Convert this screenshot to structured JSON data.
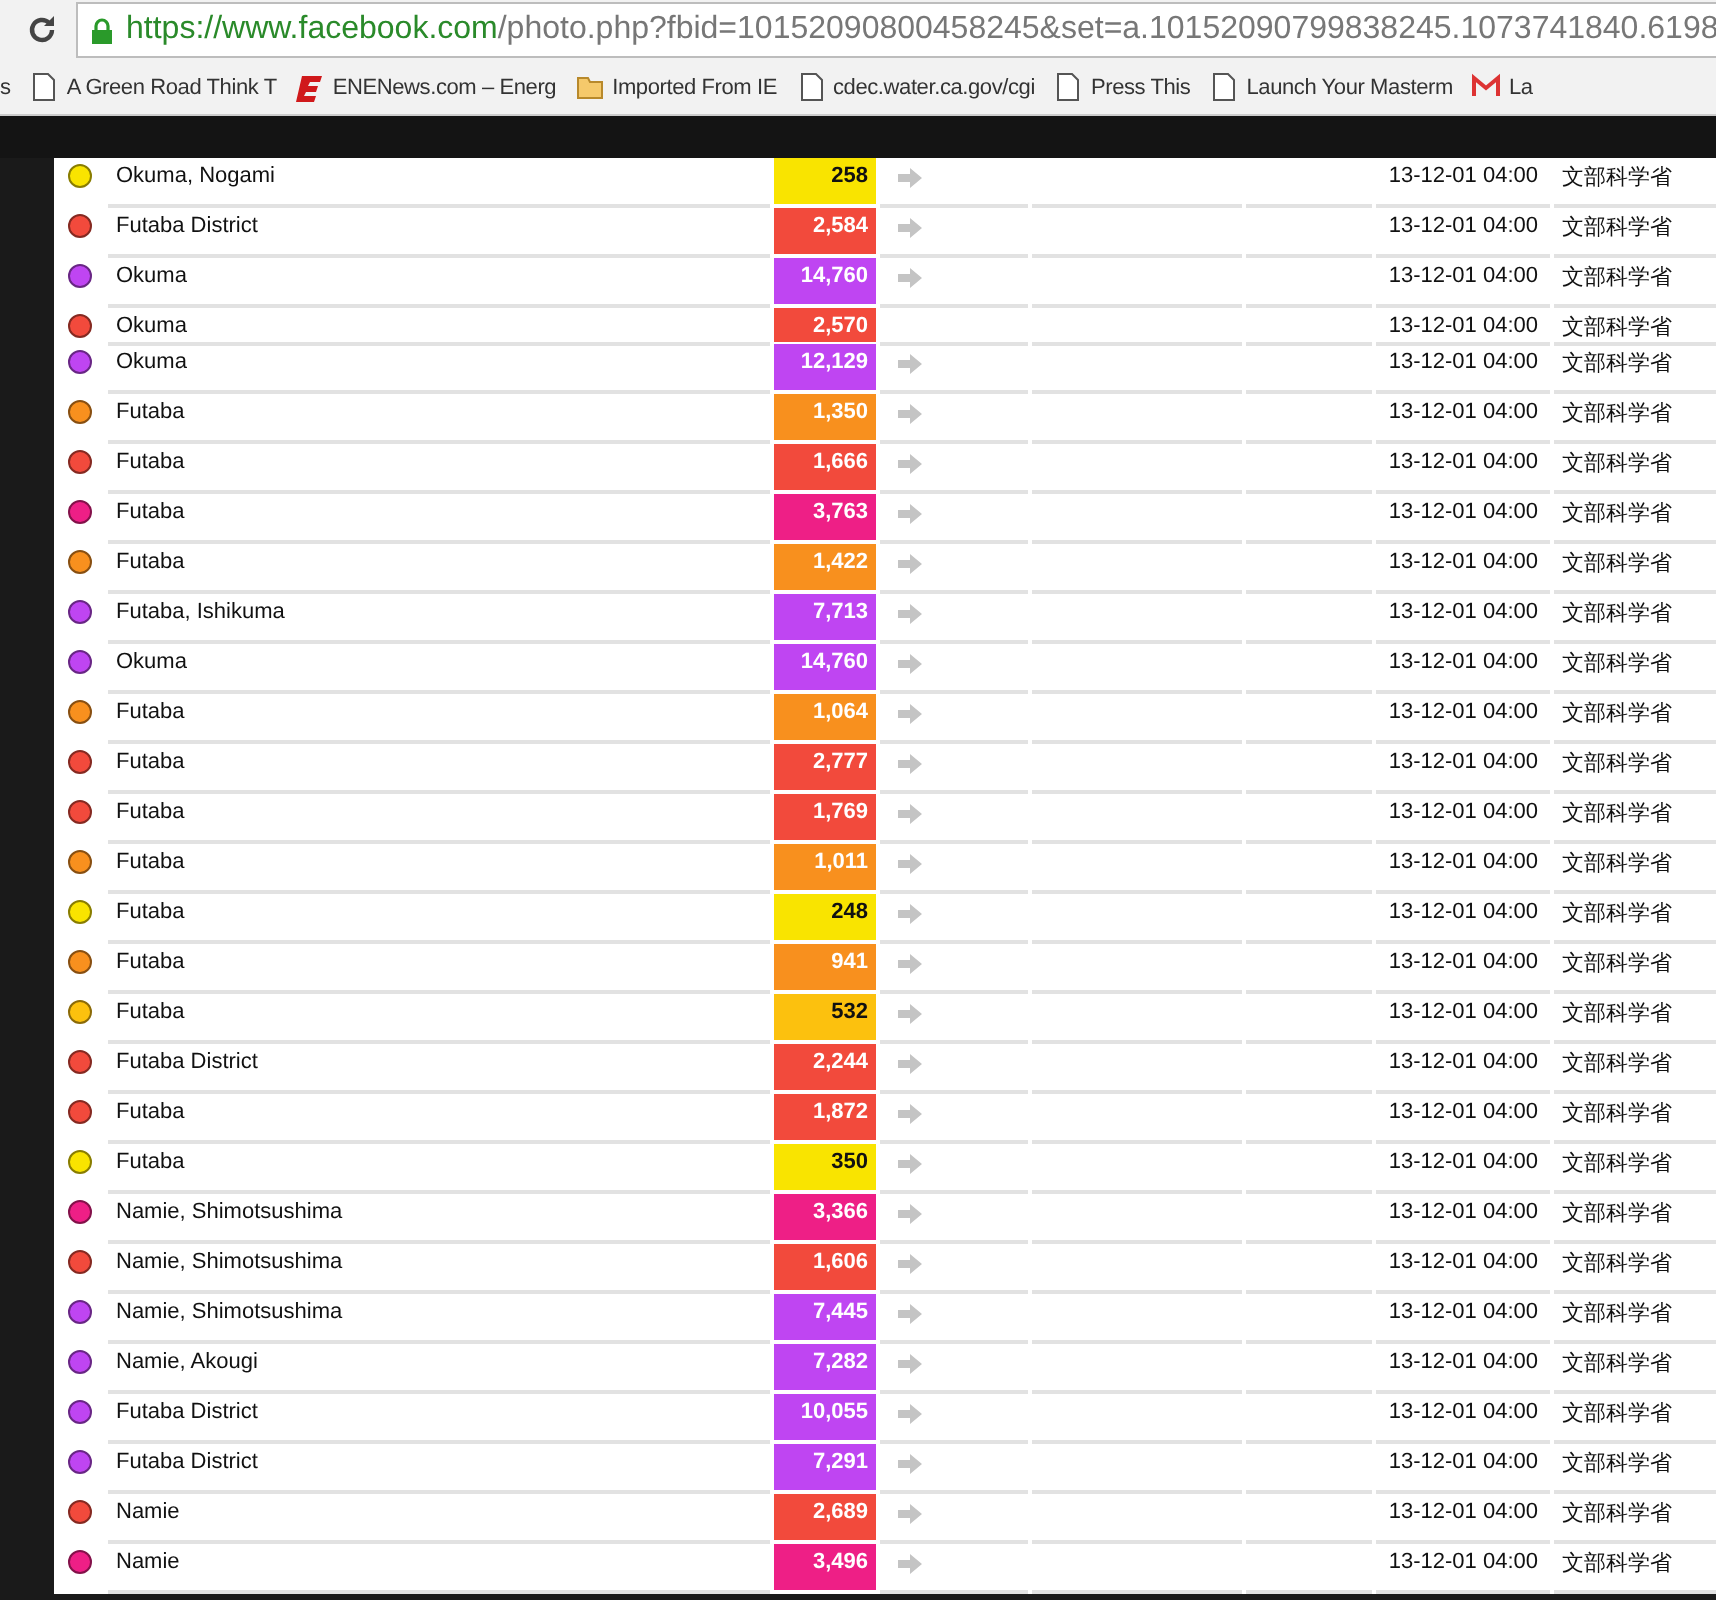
{
  "browser": {
    "url_host": "https://www.facebook.com",
    "url_path": "/photo.php?fbid=10152090800458245&set=a.10152090799838245.1073741840.6198",
    "bookmarks": [
      {
        "kind": "cut",
        "label": "s"
      },
      {
        "kind": "page",
        "label": "A Green Road Think T"
      },
      {
        "kind": "logo",
        "label": "ENENews.com – Energ"
      },
      {
        "kind": "folder",
        "label": "Imported From IE"
      },
      {
        "kind": "page",
        "label": "cdec.water.ca.gov/cgi"
      },
      {
        "kind": "page",
        "label": "Press This"
      },
      {
        "kind": "page",
        "label": "Launch Your Masterm"
      },
      {
        "kind": "mail",
        "label": "La"
      }
    ]
  },
  "table": {
    "rows": [
      {
        "name": "Okuma, Nogami",
        "value": "258",
        "color": "#f9e400",
        "arrow": true,
        "time": "13-12-01 04:00",
        "source": "文部科学省"
      },
      {
        "name": "Futaba District",
        "value": "2,584",
        "color": "#f24a3c",
        "arrow": true,
        "time": "13-12-01 04:00",
        "source": "文部科学省"
      },
      {
        "name": "Okuma",
        "value": "14,760",
        "color": "#bf45f2",
        "arrow": true,
        "time": "13-12-01 04:00",
        "source": "文部科学省"
      },
      {
        "name": "Okuma",
        "value": "2,570",
        "color": "#f24a3c",
        "arrow": false,
        "time": "13-12-01 04:00",
        "source": "文部科学省"
      },
      {
        "name": "Okuma",
        "value": "12,129",
        "color": "#bf45f2",
        "arrow": true,
        "time": "13-12-01 04:00",
        "source": "文部科学省"
      },
      {
        "name": "Futaba",
        "value": "1,350",
        "color": "#f8901e",
        "arrow": true,
        "time": "13-12-01 04:00",
        "source": "文部科学省"
      },
      {
        "name": "Futaba",
        "value": "1,666",
        "color": "#f24a3c",
        "arrow": true,
        "time": "13-12-01 04:00",
        "source": "文部科学省"
      },
      {
        "name": "Futaba",
        "value": "3,763",
        "color": "#ee1f86",
        "arrow": true,
        "time": "13-12-01 04:00",
        "source": "文部科学省"
      },
      {
        "name": "Futaba",
        "value": "1,422",
        "color": "#f8901e",
        "arrow": true,
        "time": "13-12-01 04:00",
        "source": "文部科学省"
      },
      {
        "name": "Futaba, Ishikuma",
        "value": "7,713",
        "color": "#bf45f2",
        "arrow": true,
        "time": "13-12-01 04:00",
        "source": "文部科学省"
      },
      {
        "name": "Okuma",
        "value": "14,760",
        "color": "#bf45f2",
        "arrow": true,
        "time": "13-12-01 04:00",
        "source": "文部科学省"
      },
      {
        "name": "Futaba",
        "value": "1,064",
        "color": "#f8901e",
        "arrow": true,
        "time": "13-12-01 04:00",
        "source": "文部科学省"
      },
      {
        "name": "Futaba",
        "value": "2,777",
        "color": "#f24a3c",
        "arrow": true,
        "time": "13-12-01 04:00",
        "source": "文部科学省"
      },
      {
        "name": "Futaba",
        "value": "1,769",
        "color": "#f24a3c",
        "arrow": true,
        "time": "13-12-01 04:00",
        "source": "文部科学省"
      },
      {
        "name": "Futaba",
        "value": "1,011",
        "color": "#f8901e",
        "arrow": true,
        "time": "13-12-01 04:00",
        "source": "文部科学省"
      },
      {
        "name": "Futaba",
        "value": "248",
        "color": "#f9e400",
        "arrow": true,
        "time": "13-12-01 04:00",
        "source": "文部科学省"
      },
      {
        "name": "Futaba",
        "value": "941",
        "color": "#f8901e",
        "arrow": true,
        "time": "13-12-01 04:00",
        "source": "文部科学省"
      },
      {
        "name": "Futaba",
        "value": "532",
        "color": "#fcc10e",
        "arrow": true,
        "time": "13-12-01 04:00",
        "source": "文部科学省"
      },
      {
        "name": "Futaba District",
        "value": "2,244",
        "color": "#f24a3c",
        "arrow": true,
        "time": "13-12-01 04:00",
        "source": "文部科学省"
      },
      {
        "name": "Futaba",
        "value": "1,872",
        "color": "#f24a3c",
        "arrow": true,
        "time": "13-12-01 04:00",
        "source": "文部科学省"
      },
      {
        "name": "Futaba",
        "value": "350",
        "color": "#f9e400",
        "arrow": true,
        "time": "13-12-01 04:00",
        "source": "文部科学省"
      },
      {
        "name": "Namie, Shimotsushima",
        "value": "3,366",
        "color": "#ee1f86",
        "arrow": true,
        "time": "13-12-01 04:00",
        "source": "文部科学省"
      },
      {
        "name": "Namie, Shimotsushima",
        "value": "1,606",
        "color": "#f24a3c",
        "arrow": true,
        "time": "13-12-01 04:00",
        "source": "文部科学省"
      },
      {
        "name": "Namie, Shimotsushima",
        "value": "7,445",
        "color": "#bf45f2",
        "arrow": true,
        "time": "13-12-01 04:00",
        "source": "文部科学省"
      },
      {
        "name": "Namie, Akougi",
        "value": "7,282",
        "color": "#bf45f2",
        "arrow": true,
        "time": "13-12-01 04:00",
        "source": "文部科学省"
      },
      {
        "name": "Futaba District",
        "value": "10,055",
        "color": "#bf45f2",
        "arrow": true,
        "time": "13-12-01 04:00",
        "source": "文部科学省"
      },
      {
        "name": "Futaba District",
        "value": "7,291",
        "color": "#bf45f2",
        "arrow": true,
        "time": "13-12-01 04:00",
        "source": "文部科学省"
      },
      {
        "name": "Namie",
        "value": "2,689",
        "color": "#f24a3c",
        "arrow": true,
        "time": "13-12-01 04:00",
        "source": "文部科学省"
      },
      {
        "name": "Namie",
        "value": "3,496",
        "color": "#ee1f86",
        "arrow": true,
        "time": "13-12-01 04:00",
        "source": "文部科学省"
      }
    ]
  }
}
